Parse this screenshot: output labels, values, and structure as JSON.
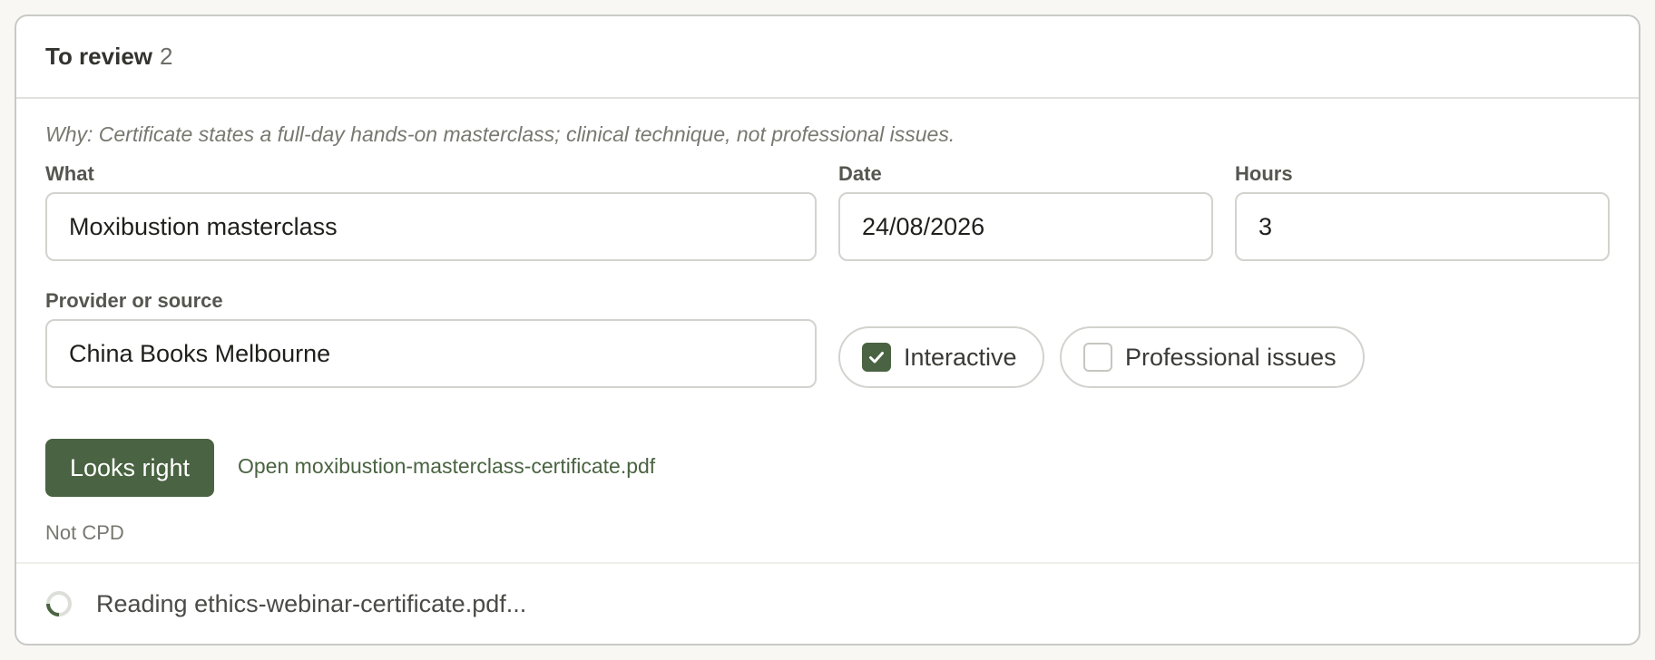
{
  "header": {
    "title": "To review",
    "count": "2"
  },
  "item": {
    "why": "Why: Certificate states a full-day hands-on masterclass; clinical technique, not professional issues.",
    "what_label": "What",
    "what_value": "Moxibustion masterclass",
    "date_label": "Date",
    "date_value": "24/08/2026",
    "hours_label": "Hours",
    "hours_value": "3",
    "provider_label": "Provider or source",
    "provider_value": "China Books Melbourne",
    "interactive_label": "Interactive",
    "interactive_checked": true,
    "professional_label": "Professional issues",
    "professional_checked": false,
    "confirm_label": "Looks right",
    "open_link_label": "Open moxibustion-masterclass-certificate.pdf",
    "status_note": "Not CPD"
  },
  "footer": {
    "loading_text": "Reading ethics-webinar-certificate.pdf..."
  },
  "colors": {
    "accent": "#4a6342",
    "border": "#d2d3ce"
  }
}
